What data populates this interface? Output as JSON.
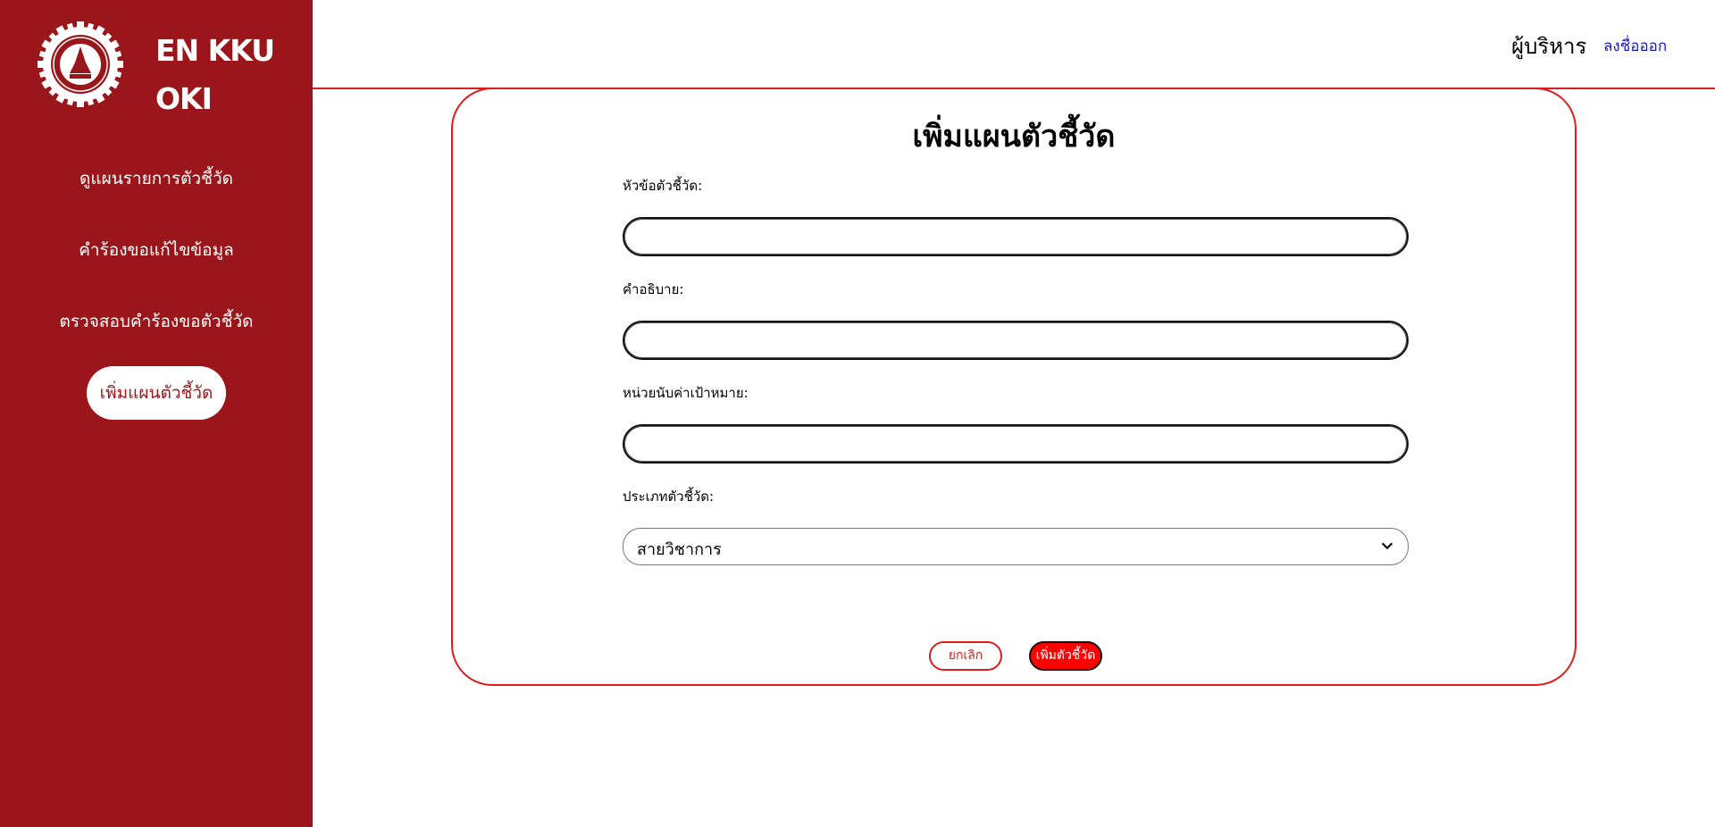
{
  "brand": {
    "line1": "EN KKU",
    "line2": "OKI",
    "logo_icon": "gear-seal-icon"
  },
  "nav": {
    "items": [
      {
        "label": "ดูแผนรายการตัวชี้วัด"
      },
      {
        "label": "คำร้องขอแก้ไขข้อมูล"
      },
      {
        "label": "ตรวจสอบคำร้องขอตัวชี้วัด"
      },
      {
        "label": "เพิ่มแผนตัวชี้วัด"
      }
    ]
  },
  "header": {
    "user_role": "ผู้บริหาร",
    "logout_label": "ลงชื่อออก"
  },
  "form": {
    "title": "เพิ่มแผนตัวชี้วัด",
    "title_label": "หัวข้อตัวชี้วัด:",
    "title_value": "",
    "description_label": "คำอธิบาย:",
    "description_value": "",
    "target_unit_label": "หน่วยนับค่าเป้าหมาย:",
    "target_unit_value": "",
    "type_label": "ประเภทตัวชี้วัด:",
    "type_value": "สายวิชาการ",
    "cancel_label": "ยกเลิก",
    "submit_label": "เพิ่มตัวชี้วัด"
  },
  "colors": {
    "sidebar": "#9a161b",
    "accent": "#e01b1b",
    "button_red": "#ff0000",
    "logout_link": "#1616d6"
  }
}
